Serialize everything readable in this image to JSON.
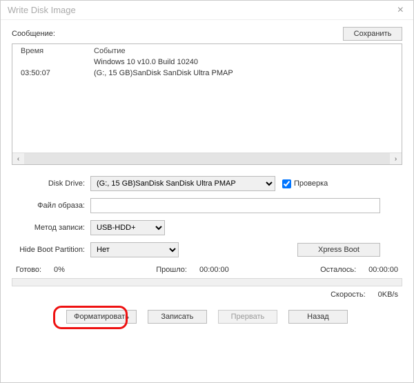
{
  "window": {
    "title": "Write Disk Image"
  },
  "message": {
    "label": "Сообщение:",
    "save": "Сохранить"
  },
  "log": {
    "headers": {
      "time": "Время",
      "event": "Событие"
    },
    "rows": [
      {
        "time": "",
        "event": "Windows 10 v10.0 Build 10240"
      },
      {
        "time": "03:50:07",
        "event": "(G:, 15 GB)SanDisk SanDisk Ultra  PMAP"
      }
    ]
  },
  "form": {
    "driveLabel": "Disk Drive:",
    "driveValue": "(G:, 15 GB)SanDisk SanDisk Ultra  PMAP",
    "checkLabel": "Проверка",
    "fileLabel": "Файл образа:",
    "fileValue": "",
    "methodLabel": "Метод записи:",
    "methodValue": "USB-HDD+",
    "hideLabel": "Hide Boot Partition:",
    "hideValue": "Нет",
    "xpress": "Xpress Boot"
  },
  "status": {
    "readyLabel": "Готово:",
    "readyValue": "0%",
    "elapsedLabel": "Прошло:",
    "elapsedValue": "00:00:00",
    "remainLabel": "Осталось:",
    "remainValue": "00:00:00",
    "speedLabel": "Скорость:",
    "speedValue": "0KB/s"
  },
  "actions": {
    "format": "Форматировать",
    "write": "Записать",
    "abort": "Прервать",
    "back": "Назад"
  }
}
